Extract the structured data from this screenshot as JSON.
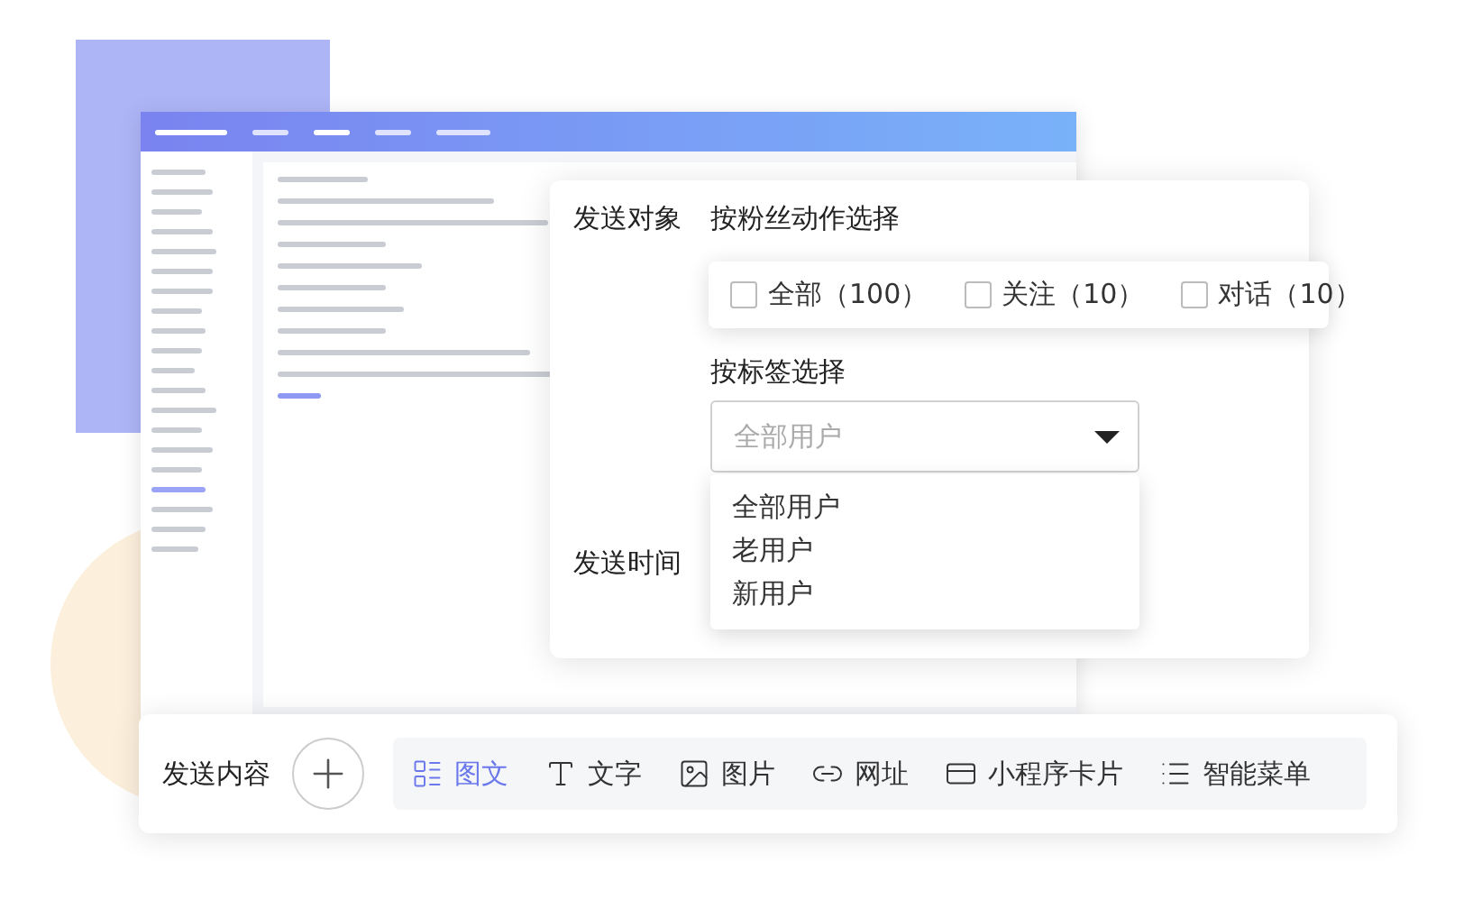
{
  "target": {
    "label": "发送对象",
    "fan_action_label": "按粉丝动作选择",
    "options": [
      {
        "label": "全部（100）",
        "checked": false
      },
      {
        "label": "关注（10）",
        "checked": false
      },
      {
        "label": "对话（10）",
        "checked": false
      }
    ],
    "tag_label": "按标签选择",
    "select": {
      "placeholder": "全部用户",
      "expanded": true,
      "options": [
        "全部用户",
        "老用户",
        "新用户"
      ]
    }
  },
  "time": {
    "label": "发送时间"
  },
  "content": {
    "label": "发送内容",
    "types": [
      {
        "kind": "article",
        "label": "图文",
        "selected": true
      },
      {
        "kind": "text",
        "label": "文字",
        "selected": false
      },
      {
        "kind": "image",
        "label": "图片",
        "selected": false
      },
      {
        "kind": "link",
        "label": "网址",
        "selected": false
      },
      {
        "kind": "card",
        "label": "小程序卡片",
        "selected": false
      },
      {
        "kind": "menu",
        "label": "智能菜单",
        "selected": false
      }
    ]
  }
}
